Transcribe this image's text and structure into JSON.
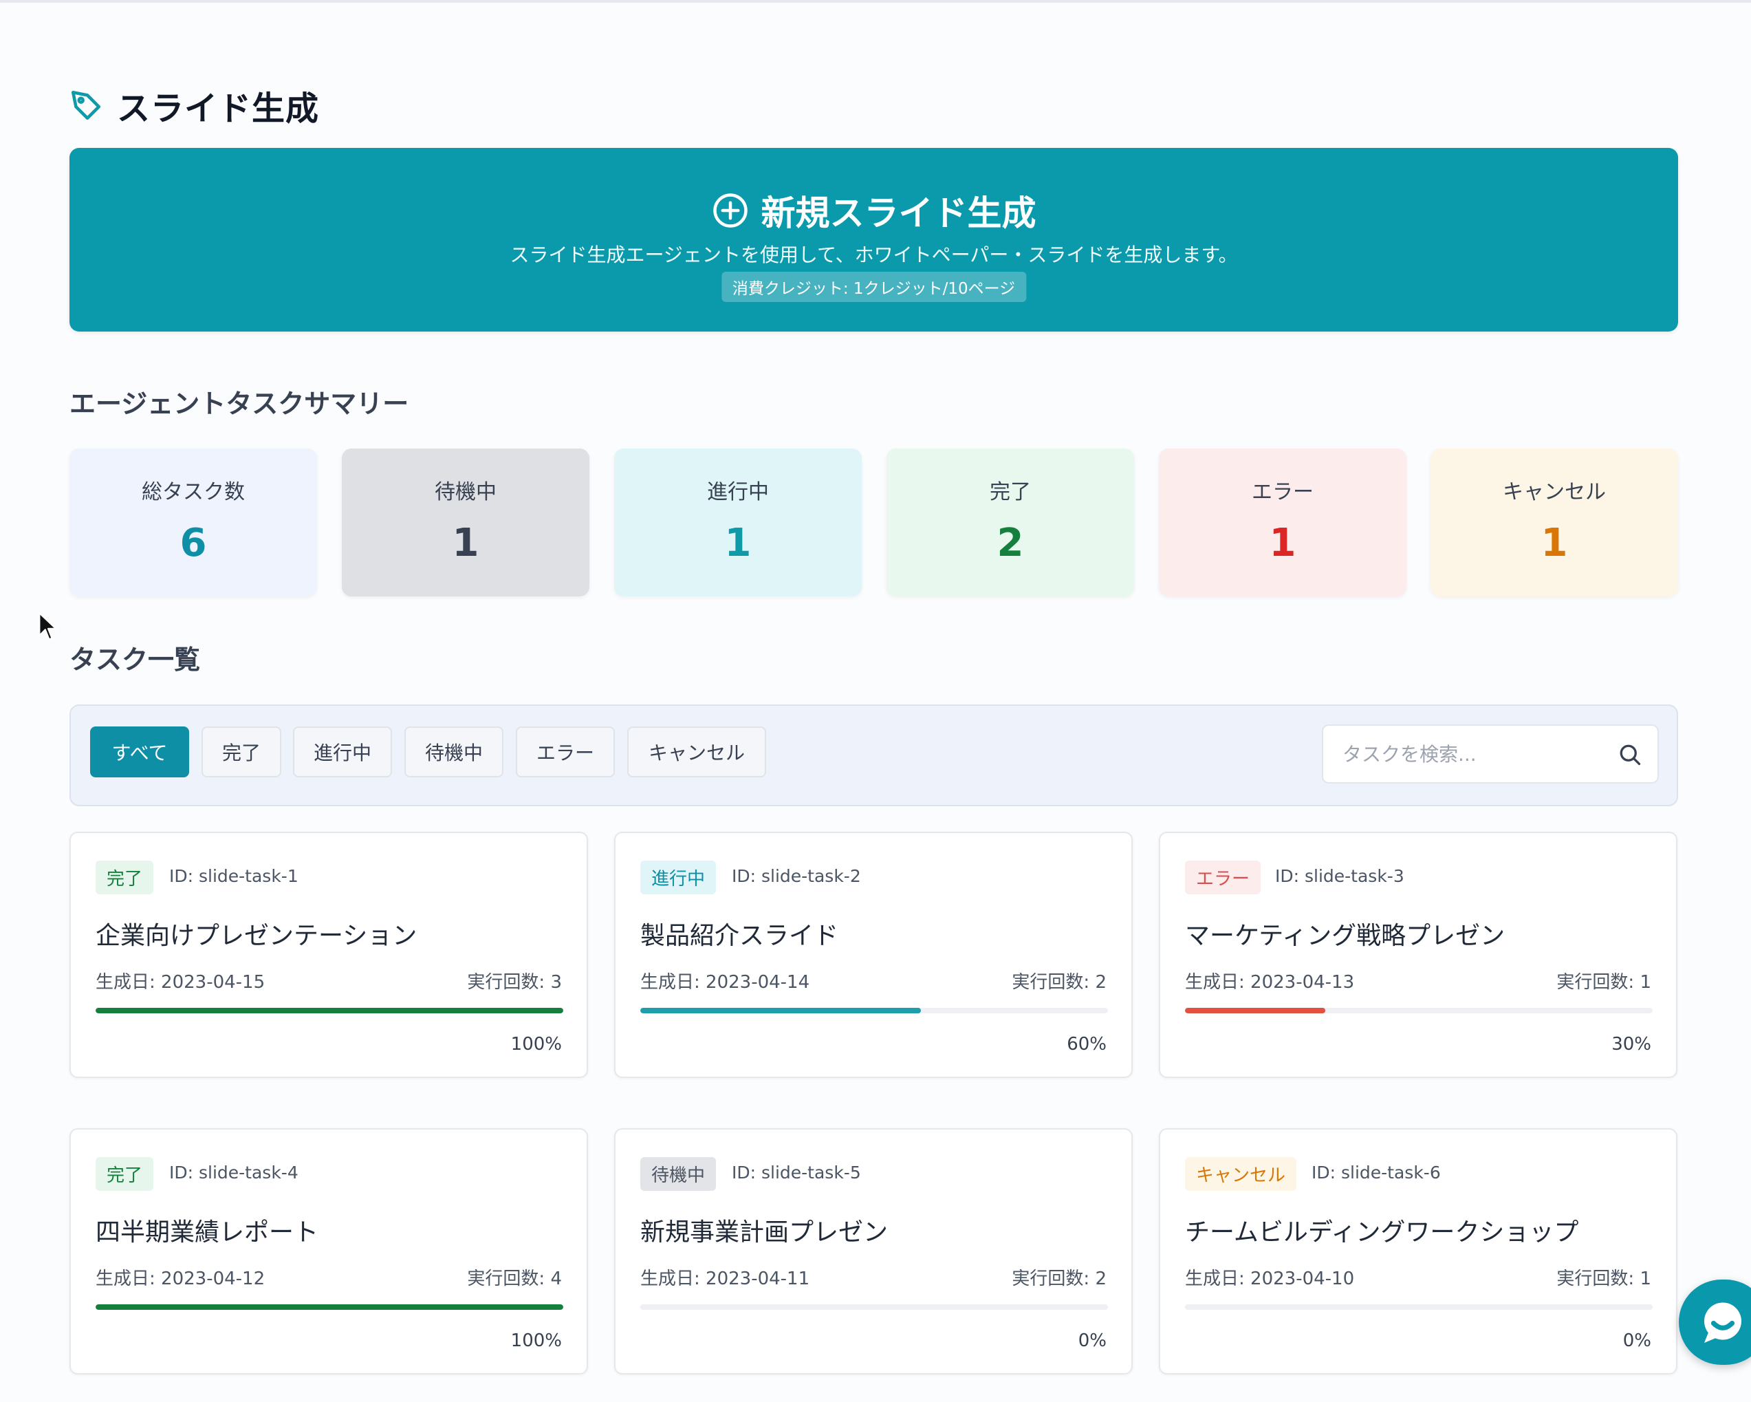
{
  "page": {
    "title": "スライド生成"
  },
  "hero": {
    "title": "新規スライド生成",
    "description": "スライド生成エージェントを使用して、ホワイトペーパー・スライドを生成します。",
    "credit": "消費クレジット: 1クレジット/10ページ"
  },
  "summary": {
    "title": "エージェントタスクサマリー",
    "stats": [
      {
        "label": "総タスク数",
        "value": "6"
      },
      {
        "label": "待機中",
        "value": "1"
      },
      {
        "label": "進行中",
        "value": "1"
      },
      {
        "label": "完了",
        "value": "2"
      },
      {
        "label": "エラー",
        "value": "1"
      },
      {
        "label": "キャンセル",
        "value": "1"
      }
    ]
  },
  "tasks": {
    "title": "タスク一覧",
    "filters": [
      "すべて",
      "完了",
      "進行中",
      "待機中",
      "エラー",
      "キャンセル"
    ],
    "active_filter": "すべて",
    "search_placeholder": "タスクを検索...",
    "items": [
      {
        "status": "完了",
        "id": "ID: slide-task-1",
        "title": "企業向けプレゼンテーション",
        "date": "生成日: 2023-04-15",
        "runs": "実行回数: 3",
        "progress": 100,
        "progress_label": "100%"
      },
      {
        "status": "進行中",
        "id": "ID: slide-task-2",
        "title": "製品紹介スライド",
        "date": "生成日: 2023-04-14",
        "runs": "実行回数: 2",
        "progress": 60,
        "progress_label": "60%"
      },
      {
        "status": "エラー",
        "id": "ID: slide-task-3",
        "title": "マーケティング戦略プレゼン",
        "date": "生成日: 2023-04-13",
        "runs": "実行回数: 1",
        "progress": 30,
        "progress_label": "30%"
      },
      {
        "status": "完了",
        "id": "ID: slide-task-4",
        "title": "四半期業績レポート",
        "date": "生成日: 2023-04-12",
        "runs": "実行回数: 4",
        "progress": 100,
        "progress_label": "100%"
      },
      {
        "status": "待機中",
        "id": "ID: slide-task-5",
        "title": "新規事業計画プレゼン",
        "date": "生成日: 2023-04-11",
        "runs": "実行回数: 2",
        "progress": 0,
        "progress_label": "0%"
      },
      {
        "status": "キャンセル",
        "id": "ID: slide-task-6",
        "title": "チームビルディングワークショップ",
        "date": "生成日: 2023-04-10",
        "runs": "実行回数: 1",
        "progress": 0,
        "progress_label": "0%"
      }
    ]
  },
  "colors": {
    "accent": "#0a9aab",
    "complete": "#15803d",
    "progress": "#0e9aa7",
    "error": "#dc2626",
    "waiting": "#4b5563",
    "cancel": "#d97706"
  },
  "icons": {
    "page_title": "tag-icon",
    "hero": "plus-circle-icon",
    "search": "search-icon",
    "chat": "chat-icon"
  }
}
